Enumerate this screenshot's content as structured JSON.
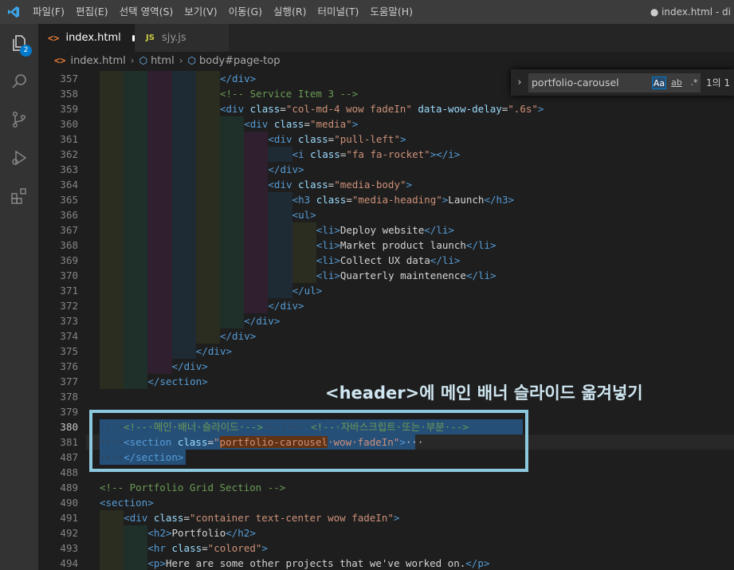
{
  "menu": [
    "파일(F)",
    "편집(E)",
    "선택 영역(S)",
    "보기(V)",
    "이동(G)",
    "실행(R)",
    "터미널(T)",
    "도움말(H)"
  ],
  "window_title": "● index.html - di",
  "activity": {
    "explorer_badge": "2"
  },
  "tabs": [
    {
      "label": "index.html",
      "icon": "html-icon",
      "dirty": true
    },
    {
      "label": "sjy.js",
      "icon": "JS"
    }
  ],
  "breadcrumb": [
    "index.html",
    "html",
    "body#page-top"
  ],
  "find": {
    "query": "portfolio-carousel",
    "opt_case": "Aa",
    "opt_word": "ab",
    "opt_regex": ".*",
    "count": "1의 1"
  },
  "annotation": "<header>에 메인 배너 슬라이드 옮겨넣기",
  "editor": {
    "active_line": "380",
    "lines": [
      {
        "num": "357",
        "tokens": [
          [
            "t-tag",
            "</div>"
          ]
        ]
      },
      {
        "num": "358",
        "tokens": [
          [
            "t-com",
            "<!-- Service Item 3 -->"
          ]
        ]
      },
      {
        "num": "359",
        "tokens": [
          [
            "t-tag",
            "<div "
          ],
          [
            "t-attr",
            "class"
          ],
          [
            "t-txt",
            "="
          ],
          [
            "t-str",
            "\"col-md-4 wow fadeIn\""
          ],
          [
            "t-txt",
            " "
          ],
          [
            "t-attr",
            "data-wow-delay"
          ],
          [
            "t-txt",
            "="
          ],
          [
            "t-str",
            "\".6s\""
          ],
          [
            "t-tag",
            ">"
          ]
        ]
      },
      {
        "num": "360",
        "tokens": [
          [
            "t-tag",
            "<div "
          ],
          [
            "t-attr",
            "class"
          ],
          [
            "t-txt",
            "="
          ],
          [
            "t-str",
            "\"media\""
          ],
          [
            "t-tag",
            ">"
          ]
        ]
      },
      {
        "num": "361",
        "tokens": [
          [
            "t-tag",
            "<div "
          ],
          [
            "t-attr",
            "class"
          ],
          [
            "t-txt",
            "="
          ],
          [
            "t-str",
            "\"pull-left\""
          ],
          [
            "t-tag",
            ">"
          ]
        ]
      },
      {
        "num": "362",
        "tokens": [
          [
            "t-tag",
            "<i "
          ],
          [
            "t-attr",
            "class"
          ],
          [
            "t-txt",
            "="
          ],
          [
            "t-str",
            "\"fa fa-rocket\""
          ],
          [
            "t-tag",
            "></i>"
          ]
        ]
      },
      {
        "num": "363",
        "tokens": [
          [
            "t-tag",
            "</div>"
          ]
        ]
      },
      {
        "num": "364",
        "tokens": [
          [
            "t-tag",
            "<div "
          ],
          [
            "t-attr",
            "class"
          ],
          [
            "t-txt",
            "="
          ],
          [
            "t-str",
            "\"media-body\""
          ],
          [
            "t-tag",
            ">"
          ]
        ]
      },
      {
        "num": "365",
        "tokens": [
          [
            "t-tag",
            "<h3 "
          ],
          [
            "t-attr",
            "class"
          ],
          [
            "t-txt",
            "="
          ],
          [
            "t-str",
            "\"media-heading\""
          ],
          [
            "t-tag",
            ">"
          ],
          [
            "t-txt",
            "Launch"
          ],
          [
            "t-tag",
            "</h3>"
          ]
        ]
      },
      {
        "num": "366",
        "tokens": [
          [
            "t-tag",
            "<ul>"
          ]
        ]
      },
      {
        "num": "367",
        "tokens": [
          [
            "t-tag",
            "<li>"
          ],
          [
            "t-txt",
            "Deploy website"
          ],
          [
            "t-tag",
            "</li>"
          ]
        ]
      },
      {
        "num": "368",
        "tokens": [
          [
            "t-tag",
            "<li>"
          ],
          [
            "t-txt",
            "Market product launch"
          ],
          [
            "t-tag",
            "</li>"
          ]
        ]
      },
      {
        "num": "369",
        "tokens": [
          [
            "t-tag",
            "<li>"
          ],
          [
            "t-txt",
            "Collect UX data"
          ],
          [
            "t-tag",
            "</li>"
          ]
        ]
      },
      {
        "num": "370",
        "tokens": [
          [
            "t-tag",
            "<li>"
          ],
          [
            "t-txt",
            "Quarterly maintenence"
          ],
          [
            "t-tag",
            "</li>"
          ]
        ]
      },
      {
        "num": "371",
        "tokens": [
          [
            "t-tag",
            "</ul>"
          ]
        ]
      },
      {
        "num": "372",
        "tokens": [
          [
            "t-tag",
            "</div>"
          ]
        ]
      },
      {
        "num": "373",
        "tokens": [
          [
            "t-tag",
            "</div>"
          ]
        ]
      },
      {
        "num": "374",
        "tokens": [
          [
            "t-tag",
            "</div>"
          ]
        ]
      },
      {
        "num": "375",
        "tokens": [
          [
            "t-tag",
            "</div>"
          ]
        ]
      },
      {
        "num": "376",
        "tokens": [
          [
            "t-tag",
            "</div>"
          ]
        ]
      },
      {
        "num": "377",
        "tokens": [
          [
            "t-tag",
            "</section>"
          ]
        ]
      },
      {
        "num": "378",
        "tokens": []
      },
      {
        "num": "379",
        "tokens": []
      },
      {
        "num": "380",
        "tokens": [
          [
            "t-ws",
            "····"
          ],
          [
            "t-com",
            "<!--·메인·배너·슬라이드·-->"
          ],
          [
            "t-ws",
            "········"
          ],
          [
            "t-com",
            "<!--·자바스크립트·또는·부분·-->"
          ]
        ]
      },
      {
        "num": "381",
        "tokens": [
          [
            "t-ws",
            "····"
          ],
          [
            "t-tag",
            "<section "
          ],
          [
            "t-attr",
            "class"
          ],
          [
            "t-txt",
            "="
          ],
          [
            "t-str",
            "\""
          ],
          [
            "t-str find-match",
            "portfolio-carousel"
          ],
          [
            "t-str",
            "·wow·fadeIn\""
          ],
          [
            "t-tag",
            ">"
          ],
          [
            "t-fold",
            "···"
          ]
        ]
      },
      {
        "num": "487",
        "tokens": [
          [
            "t-ws",
            "····"
          ],
          [
            "t-tag",
            "</section>"
          ]
        ]
      },
      {
        "num": "488",
        "tokens": []
      },
      {
        "num": "489",
        "tokens": [
          [
            "t-com",
            "<!-- Portfolio Grid Section -->"
          ]
        ]
      },
      {
        "num": "490",
        "tokens": [
          [
            "t-tag",
            "<section>"
          ]
        ]
      },
      {
        "num": "491",
        "tokens": [
          [
            "t-tag",
            "<div "
          ],
          [
            "t-attr",
            "class"
          ],
          [
            "t-txt",
            "="
          ],
          [
            "t-str",
            "\"container text-center wow fadeIn\""
          ],
          [
            "t-tag",
            ">"
          ]
        ]
      },
      {
        "num": "492",
        "tokens": [
          [
            "t-tag",
            "<h2>"
          ],
          [
            "t-txt",
            "Portfolio"
          ],
          [
            "t-tag",
            "</h2>"
          ]
        ]
      },
      {
        "num": "493",
        "tokens": [
          [
            "t-tag",
            "<hr "
          ],
          [
            "t-attr",
            "class"
          ],
          [
            "t-txt",
            "="
          ],
          [
            "t-str",
            "\"colored\""
          ],
          [
            "t-tag",
            ">"
          ]
        ]
      },
      {
        "num": "494",
        "tokens": [
          [
            "t-tag",
            "<p>"
          ],
          [
            "t-txt",
            "Here are some other projects that we've worked on."
          ],
          [
            "t-tag",
            "</p>"
          ]
        ]
      }
    ]
  }
}
